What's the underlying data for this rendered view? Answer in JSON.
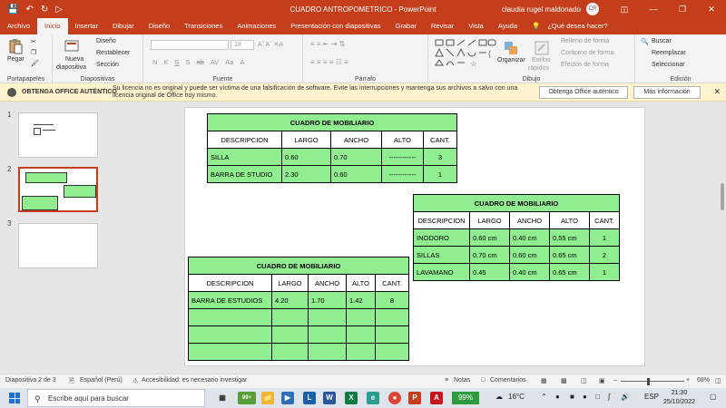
{
  "titlebar": {
    "title": "CUADRO ANTROPOMETRICO  -  PowerPoint",
    "user": "claudia rugel maldonado",
    "avatar": "CR",
    "quick_access": [
      "save-icon",
      "undo-icon",
      "redo-icon",
      "present-icon"
    ]
  },
  "tabs": [
    "Archivo",
    "Inicio",
    "Insertar",
    "Dibujar",
    "Diseño",
    "Transiciones",
    "Animaciones",
    "Presentación con diapositivas",
    "Grabar",
    "Revisar",
    "Vista",
    "Ayuda"
  ],
  "tell_me": "¿Qué desea hacer?",
  "ribbon": {
    "clipboard": {
      "paste": "Pegar",
      "label": "Portapapeles"
    },
    "slides": {
      "new_slide_1": "Nueva",
      "new_slide_2": "diapositiva",
      "layout": "Diseño",
      "reset": "Restablecer",
      "section": "Sección",
      "label": "Diapositivas"
    },
    "font": {
      "size": "18",
      "label": "Fuente",
      "format_buttons": [
        "N",
        "K",
        "S",
        "S",
        "ab",
        "AV",
        "Aa",
        "A"
      ]
    },
    "paragraph": {
      "label": "Párrafo"
    },
    "drawing": {
      "arrange": "Organizar",
      "styles_1": "Estilos",
      "styles_2": "rápidos",
      "fill": "Relleno de forma",
      "outline": "Contorno de forma",
      "effects": "Efectos de forma",
      "label": "Dibujo"
    },
    "editing": {
      "find": "Buscar",
      "replace": "Reemplazar",
      "select": "Seleccionar",
      "label": "Edición"
    }
  },
  "warning": {
    "title": "OBTENGA OFFICE AUTÉNTICO",
    "message": "Su licencia no es original y puede ser víctima de una falsificación de software. Evite las interrupciones y mantenga sus archivos a salvo con una licencia original de Office hoy mismo.",
    "button_1": "Obtenga Office auténtico",
    "button_2": "Más información"
  },
  "thumbnails": [
    "1",
    "2",
    "3"
  ],
  "tables": [
    {
      "title": "CUADRO DE MOBILIARIO",
      "headers": [
        "DESCRIPCION",
        "LARGO",
        "ANCHO",
        "ALTO",
        "CANT."
      ],
      "rows": [
        [
          "SILLA",
          "0.60",
          "0.70",
          "------------",
          "3"
        ],
        [
          "BARRA DE STUDIO",
          "2.30",
          "0.60",
          "------------",
          "1"
        ]
      ]
    },
    {
      "title": "CUADRO DE MOBILIARIO",
      "headers": [
        "DESCRIPCION",
        "LARGO",
        "ANCHO",
        "ALTO",
        "CANT."
      ],
      "rows": [
        [
          "INODORO",
          "0.60 cm",
          "0.40 cm",
          "0.55 cm",
          "1"
        ],
        [
          "SILLAS",
          "0.70 cm",
          "0.60 cm",
          "0.65 cm",
          "2"
        ],
        [
          "LAVAMANO",
          "0.45",
          "0.40 cm",
          "0.65 cm",
          "1"
        ]
      ]
    },
    {
      "title": "CUADRO DE MOBILIARIO",
      "headers": [
        "DESCRIPCION",
        "LARGO",
        "ANCHO",
        "ALTO",
        "CANT."
      ],
      "rows": [
        [
          "BARRA DE ESTUDIOS",
          "4.20",
          "1.70",
          "1.42",
          "8"
        ],
        [
          "",
          "",
          "",
          "",
          ""
        ],
        [
          "",
          "",
          "",
          "",
          ""
        ],
        [
          "",
          "",
          "",
          "",
          ""
        ]
      ]
    }
  ],
  "status": {
    "slide": "Diapositiva 2 de 3",
    "language": "Español (Perú)",
    "accessibility": "Accesibilidad: es necesario investigar",
    "notes": "Notas",
    "comments": "Comentarios",
    "zoom": "68%"
  },
  "taskbar": {
    "search_placeholder": "Escribe aquí para buscar",
    "battery": "99%",
    "temperature": "16°C",
    "language": "ESP",
    "time": "21:30",
    "date": "25/10/2022",
    "badge": "99+"
  },
  "colors": {
    "accent": "#c43e1c",
    "table_fill": "#90ee90",
    "warning_bg": "#fff4ce"
  }
}
